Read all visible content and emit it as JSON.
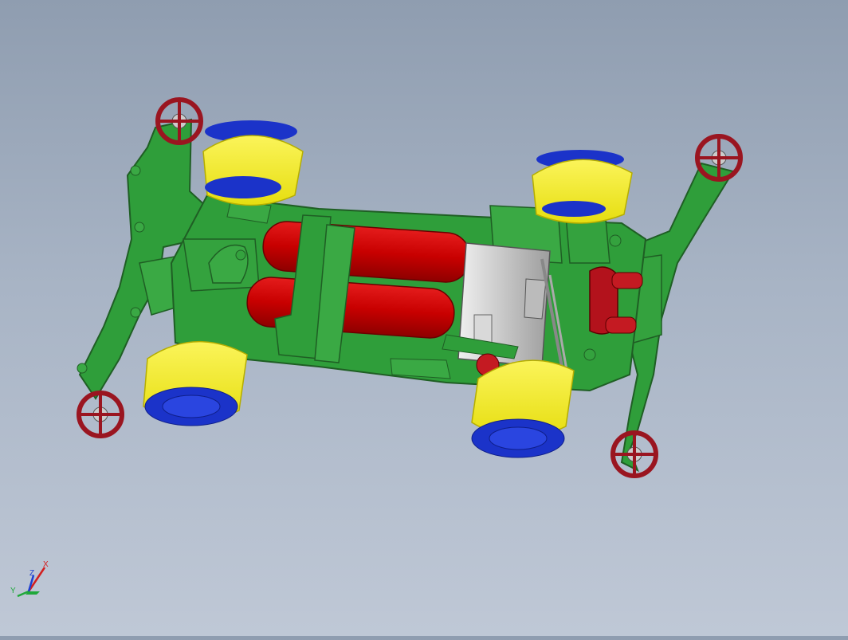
{
  "viewport": {
    "background_top": "#8f9db0",
    "background_bottom": "#bfc8d6",
    "model_colors": {
      "chassis": "#2f9e3a",
      "chassis_edge": "#1f5e24",
      "tire": "#f2ec1a",
      "wheel": "#1b33c9",
      "battery": "#c80000",
      "roller": "#9a1520",
      "motor": "#c9c9c9"
    }
  },
  "triad": {
    "x_label": "X",
    "y_label": "Y",
    "z_label": "Z",
    "x_color": "#d21e1e",
    "y_color": "#1fa83a",
    "z_color": "#1e3fd2"
  }
}
